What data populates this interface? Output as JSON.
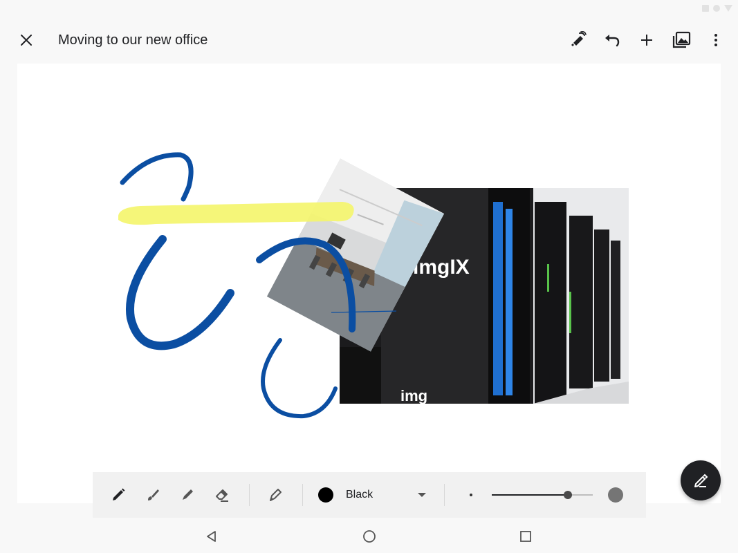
{
  "app_bar": {
    "title": "Moving to our new office",
    "icons": {
      "close": "close-icon",
      "pen_mode": "stylus-pen-icon",
      "undo": "undo-icon",
      "add": "add-icon",
      "images": "image-library-icon",
      "more": "more-vert-icon"
    }
  },
  "canvas": {
    "photos": [
      {
        "name": "server-room-photo",
        "sign_text": "imgIX",
        "sign_text_bottom": "img"
      },
      {
        "name": "conference-room-photo"
      }
    ],
    "ink_colors": {
      "blue": "#0b4ea2",
      "highlighter": "#f4f56a"
    }
  },
  "toolbar": {
    "tools": [
      {
        "name": "pen-tool",
        "icon": "pen-icon"
      },
      {
        "name": "brush-tool",
        "icon": "brush-icon"
      },
      {
        "name": "marker-tool",
        "icon": "marker-icon"
      },
      {
        "name": "eraser-tool",
        "icon": "eraser-icon"
      },
      {
        "name": "highlighter-tool",
        "icon": "highlighter-icon"
      }
    ],
    "color": {
      "label": "Black",
      "value": "#000000"
    },
    "stroke_size": 0.75
  },
  "fab": {
    "icon": "edit-pen-icon"
  },
  "nav": {
    "back": "back-icon",
    "home": "home-icon",
    "recents": "recents-icon"
  }
}
